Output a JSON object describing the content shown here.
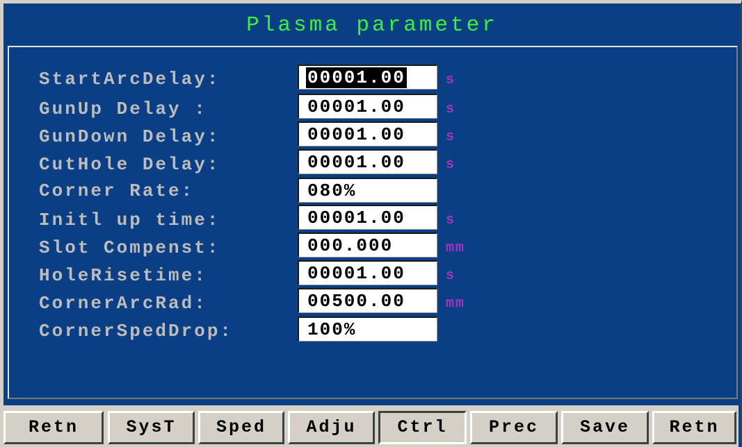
{
  "window": {
    "title": "Plasma parameter"
  },
  "parameters": [
    {
      "label": "StartArcDelay:",
      "value": "00001.00",
      "unit": "s",
      "selected": true
    },
    {
      "label": "GunUp Delay :",
      "value": "00001.00",
      "unit": "s"
    },
    {
      "label": "GunDown Delay:",
      "value": "00001.00",
      "unit": "s"
    },
    {
      "label": "CutHole Delay:",
      "value": "00001.00",
      "unit": "s"
    },
    {
      "label": "Corner Rate:",
      "value": "080%",
      "unit": ""
    },
    {
      "label": "Initl up time:",
      "value": "00001.00",
      "unit": "s"
    },
    {
      "label": "Slot Compenst:",
      "value": "000.000",
      "unit": "mm"
    },
    {
      "label": "HoleRisetime:",
      "value": "00001.00",
      "unit": "s"
    },
    {
      "label": "CornerArcRad:",
      "value": "00500.00",
      "unit": "mm"
    },
    {
      "label": "CornerSpedDrop:",
      "value": "100%",
      "unit": ""
    }
  ],
  "toolbar": {
    "buttons": [
      {
        "label": "Retn"
      },
      {
        "label": "SysT"
      },
      {
        "label": "Sped"
      },
      {
        "label": "Adju"
      },
      {
        "label": "Ctrl",
        "pressed": true
      },
      {
        "label": "Prec"
      },
      {
        "label": "Save"
      },
      {
        "label": "Retn"
      }
    ]
  },
  "colors": {
    "background": "#0a3f86",
    "title": "#3cf03c",
    "label": "#bcbcbc",
    "unit": "#a235c0",
    "toolbar": "#d4d0c8"
  }
}
